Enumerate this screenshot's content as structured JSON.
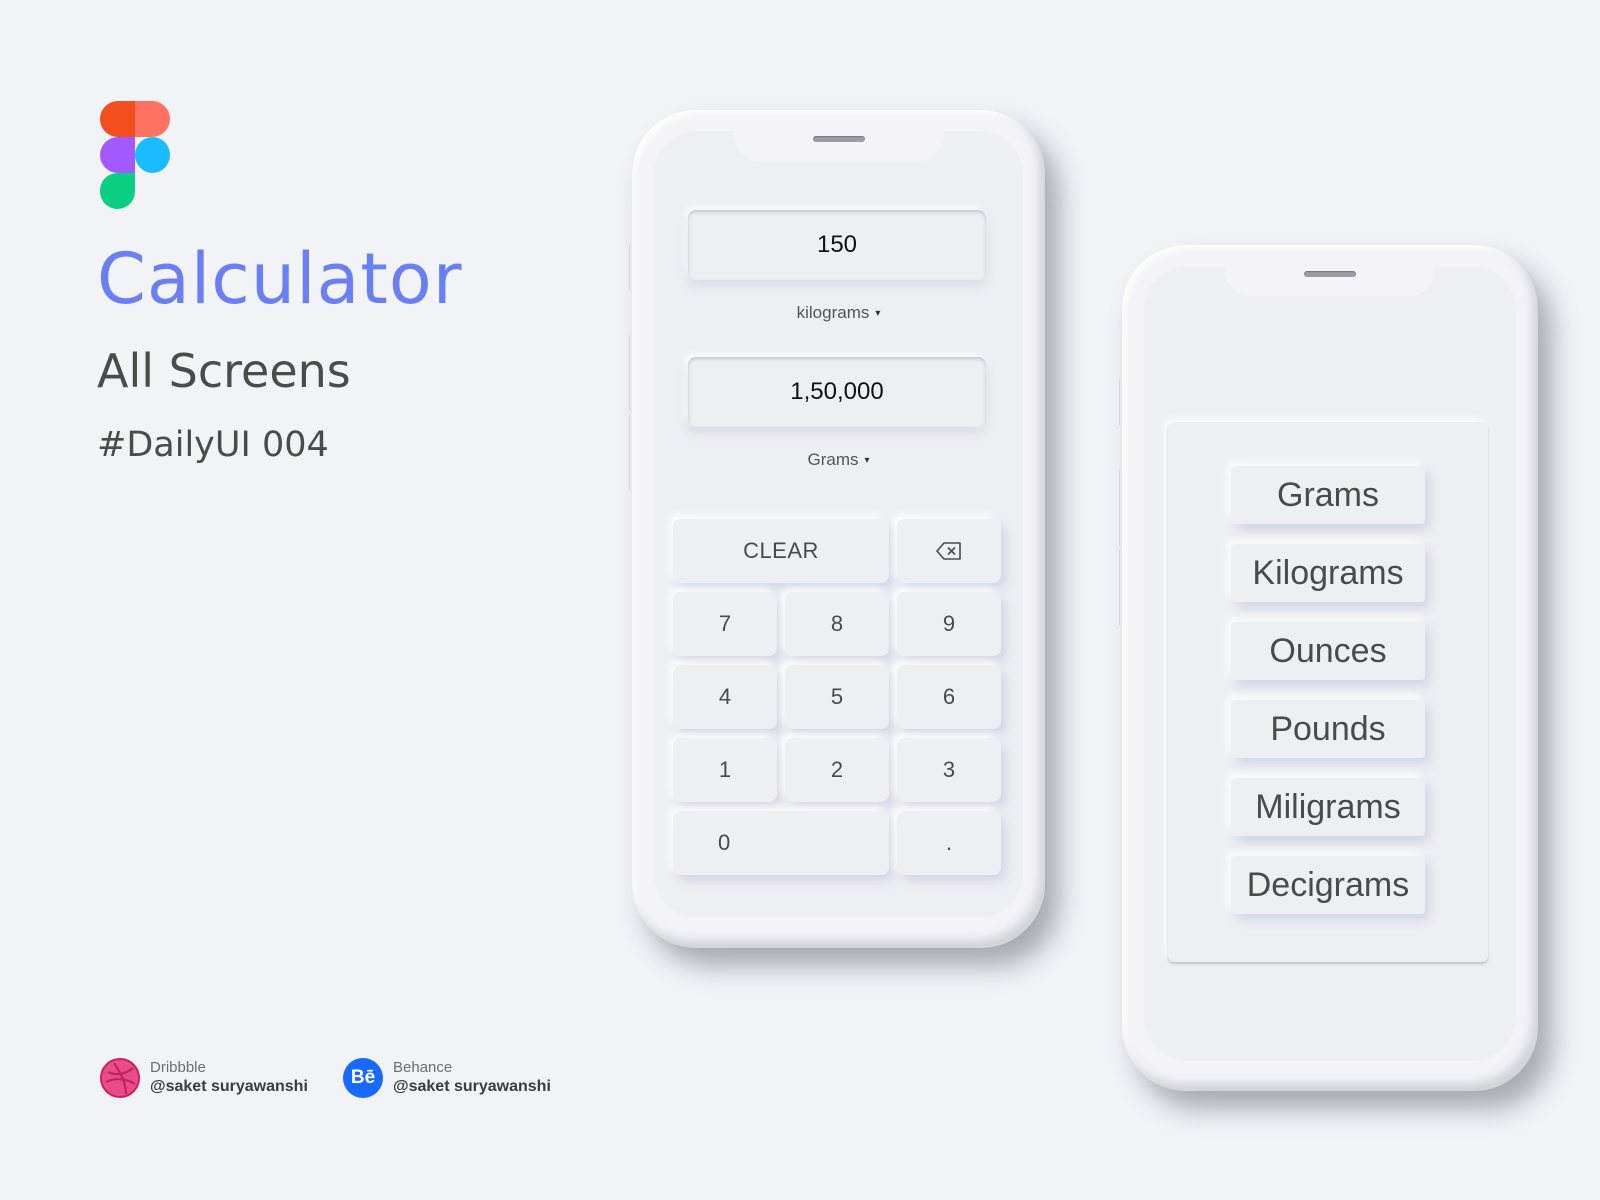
{
  "branding": {
    "logo": "figma-logo",
    "title": "Calculator",
    "subtitle": "All Screens",
    "tagline": "#DailyUI 004",
    "title_color": "#6b7ff5"
  },
  "social": [
    {
      "platform": "Dribbble",
      "handle": "@saket suryawanshi",
      "icon": "dribbble-icon",
      "color": "#ea4c89"
    },
    {
      "platform": "Behance",
      "handle": "@saket suryawanshi",
      "icon": "behance-icon",
      "icon_text": "Bē",
      "color": "#1769ff"
    }
  ],
  "converter_screen": {
    "input": {
      "value": "150",
      "unit": "kilograms"
    },
    "output": {
      "value": "1,50,000",
      "unit": "Grams"
    },
    "dropdown_caret": "▾",
    "keys": {
      "clear": "CLEAR",
      "backspace_icon": "backspace-icon",
      "k7": "7",
      "k8": "8",
      "k9": "9",
      "k4": "4",
      "k5": "5",
      "k6": "6",
      "k1": "1",
      "k2": "2",
      "k3": "3",
      "k0": "0",
      "dot": "."
    }
  },
  "unit_screen": {
    "units": [
      "Grams",
      "Kilograms",
      "Ounces",
      "Pounds",
      "Miligrams",
      "Decigrams"
    ]
  }
}
